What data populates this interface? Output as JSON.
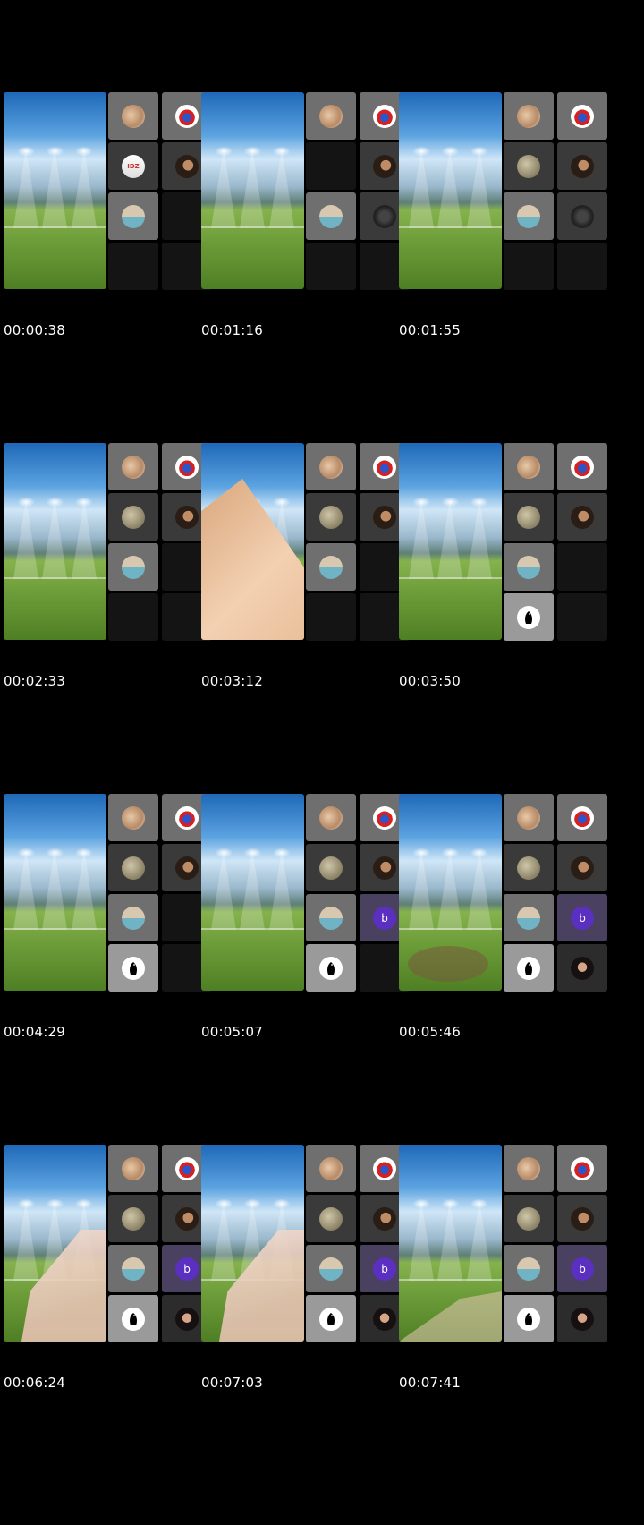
{
  "frames": [
    {
      "timestamp": "00:00:38",
      "stage_overlay": "none",
      "tiles": [
        "face1",
        "flag",
        "poster",
        "woman",
        "beach",
        "empty",
        "empty",
        "empty"
      ]
    },
    {
      "timestamp": "00:01:16",
      "stage_overlay": "none",
      "tiles": [
        "face1",
        "flag",
        "empty",
        "woman",
        "beach",
        "dude",
        "empty",
        "empty"
      ]
    },
    {
      "timestamp": "00:01:55",
      "stage_overlay": "none",
      "tiles": [
        "face1",
        "flag",
        "moon",
        "woman",
        "beach",
        "dude",
        "empty",
        "empty"
      ]
    },
    {
      "timestamp": "00:02:33",
      "stage_overlay": "none",
      "tiles": [
        "face1",
        "flag",
        "moon",
        "woman",
        "beach",
        "empty",
        "empty",
        "empty"
      ]
    },
    {
      "timestamp": "00:03:12",
      "stage_overlay": "pyramid",
      "tiles": [
        "face1",
        "flag",
        "moon",
        "woman",
        "beach",
        "empty",
        "empty",
        "empty"
      ]
    },
    {
      "timestamp": "00:03:50",
      "stage_overlay": "none",
      "tiles": [
        "face1",
        "flag",
        "moon",
        "woman",
        "beach",
        "empty",
        "penguin",
        "empty"
      ]
    },
    {
      "timestamp": "00:04:29",
      "stage_overlay": "none",
      "tiles": [
        "face1",
        "flag",
        "moon",
        "woman",
        "beach",
        "empty",
        "penguin",
        "empty"
      ]
    },
    {
      "timestamp": "00:05:07",
      "stage_overlay": "none",
      "tiles": [
        "face1",
        "flag",
        "moon",
        "woman",
        "beach",
        "b",
        "penguin",
        "empty"
      ]
    },
    {
      "timestamp": "00:05:46",
      "stage_overlay": "blob",
      "tiles": [
        "face1",
        "flag",
        "moon",
        "woman",
        "beach",
        "b",
        "penguin",
        "woman2"
      ]
    },
    {
      "timestamp": "00:06:24",
      "stage_overlay": "cloth",
      "tiles": [
        "face1",
        "flag",
        "moon",
        "woman",
        "beach",
        "b",
        "penguin",
        "woman2"
      ]
    },
    {
      "timestamp": "00:07:03",
      "stage_overlay": "cloth",
      "tiles": [
        "face1",
        "flag",
        "moon",
        "woman",
        "beach",
        "b",
        "penguin",
        "woman2"
      ]
    },
    {
      "timestamp": "00:07:41",
      "stage_overlay": "cloth2",
      "tiles": [
        "face1",
        "flag",
        "moon",
        "woman",
        "beach",
        "b",
        "penguin",
        "woman2"
      ]
    }
  ],
  "avatar_letter": "b",
  "poster_text": "IDZ",
  "colors": {
    "background": "#000000",
    "timestamp_text": "#ffffff",
    "avatar_b": "#5b2fc0"
  }
}
